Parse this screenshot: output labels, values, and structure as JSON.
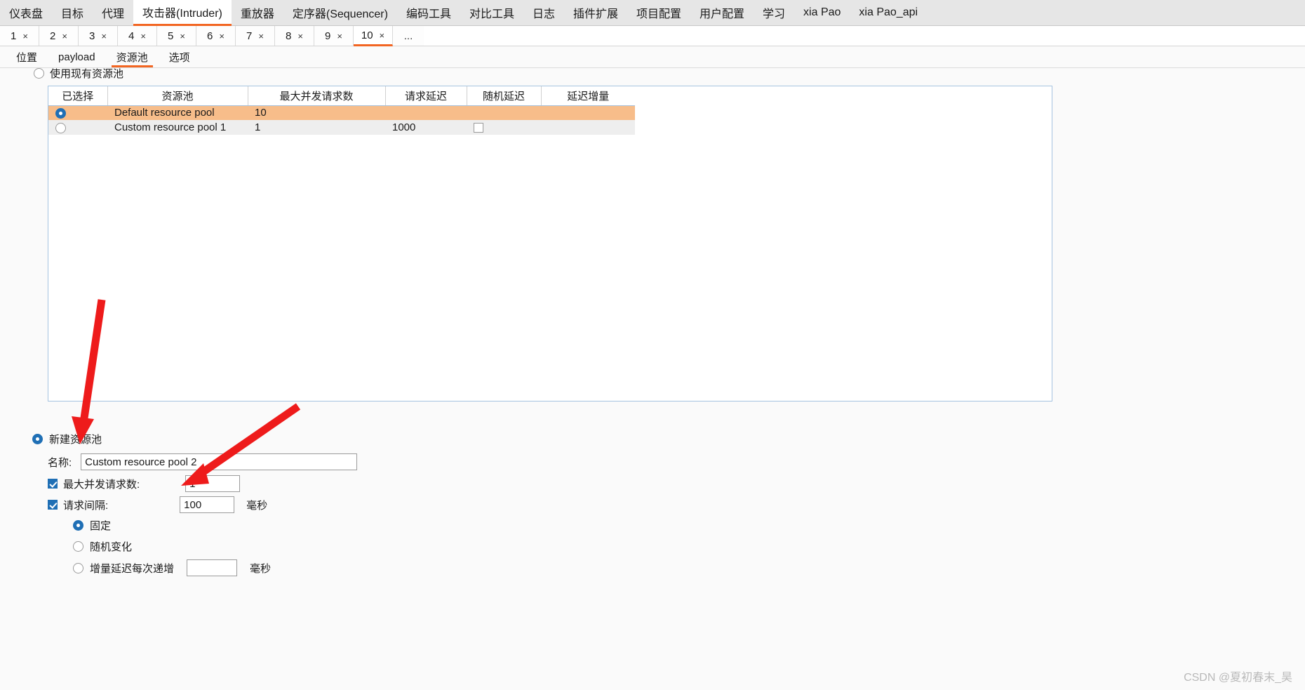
{
  "main_tabs": [
    {
      "label": "仪表盘",
      "active": false
    },
    {
      "label": "目标",
      "active": false
    },
    {
      "label": "代理",
      "active": false
    },
    {
      "label": "攻击器(Intruder)",
      "active": true
    },
    {
      "label": "重放器",
      "active": false
    },
    {
      "label": "定序器(Sequencer)",
      "active": false
    },
    {
      "label": "编码工具",
      "active": false
    },
    {
      "label": "对比工具",
      "active": false
    },
    {
      "label": "日志",
      "active": false
    },
    {
      "label": "插件扩展",
      "active": false
    },
    {
      "label": "项目配置",
      "active": false
    },
    {
      "label": "用户配置",
      "active": false
    },
    {
      "label": "学习",
      "active": false
    },
    {
      "label": "xia Pao",
      "active": false
    },
    {
      "label": "xia Pao_api",
      "active": false
    }
  ],
  "attack_tabs": [
    {
      "label": "1",
      "close": "×",
      "active": false
    },
    {
      "label": "2",
      "close": "×",
      "active": false
    },
    {
      "label": "3",
      "close": "×",
      "active": false
    },
    {
      "label": "4",
      "close": "×",
      "active": false
    },
    {
      "label": "5",
      "close": "×",
      "active": false
    },
    {
      "label": "6",
      "close": "×",
      "active": false
    },
    {
      "label": "7",
      "close": "×",
      "active": false
    },
    {
      "label": "8",
      "close": "×",
      "active": false
    },
    {
      "label": "9",
      "close": "×",
      "active": false
    },
    {
      "label": "10",
      "close": "×",
      "active": true
    }
  ],
  "attack_tabs_overflow": "...",
  "sub_tabs": [
    {
      "label": "位置",
      "active": false
    },
    {
      "label": "payload",
      "active": false
    },
    {
      "label": "资源池",
      "active": true
    },
    {
      "label": "选项",
      "active": false
    }
  ],
  "existing_pool": {
    "label": "使用现有资源池",
    "selected": false
  },
  "table": {
    "headers": [
      "已选择",
      "资源池",
      "最大并发请求数",
      "请求延迟",
      "随机延迟",
      "延迟增量"
    ],
    "rows": [
      {
        "selected": true,
        "pool": "Default resource pool",
        "max_concurrent": "10",
        "request_delay": "",
        "random_delay": "",
        "random_delay_checkbox": false,
        "has_random_checkbox": false,
        "delay_increment": ""
      },
      {
        "selected": false,
        "pool": "Custom resource pool 1",
        "max_concurrent": "1",
        "request_delay": "1000",
        "random_delay": "",
        "random_delay_checkbox": false,
        "has_random_checkbox": true,
        "delay_increment": ""
      }
    ]
  },
  "new_pool": {
    "radio_label": "新建资源池",
    "selected": true,
    "name_label": "名称:",
    "name_value": "Custom resource pool 2",
    "max_concurrent_label": "最大并发请求数:",
    "max_concurrent_checked": true,
    "max_concurrent_value": "1",
    "interval_label": "请求间隔:",
    "interval_checked": true,
    "interval_value": "100",
    "interval_unit": "毫秒",
    "options": [
      {
        "label": "固定",
        "selected": true,
        "has_input": false,
        "input_value": "",
        "unit": ""
      },
      {
        "label": "随机变化",
        "selected": false,
        "has_input": false,
        "input_value": "",
        "unit": ""
      },
      {
        "label": "增量延迟每次递增",
        "selected": false,
        "has_input": true,
        "input_value": "",
        "unit": "毫秒"
      }
    ]
  },
  "watermark": "CSDN @夏初春末_昊",
  "colors": {
    "accent": "#f26522",
    "selected_row": "#f7bd8a",
    "radio_blue": "#1f6fb5",
    "annotation_red": "#ee1b1b"
  }
}
